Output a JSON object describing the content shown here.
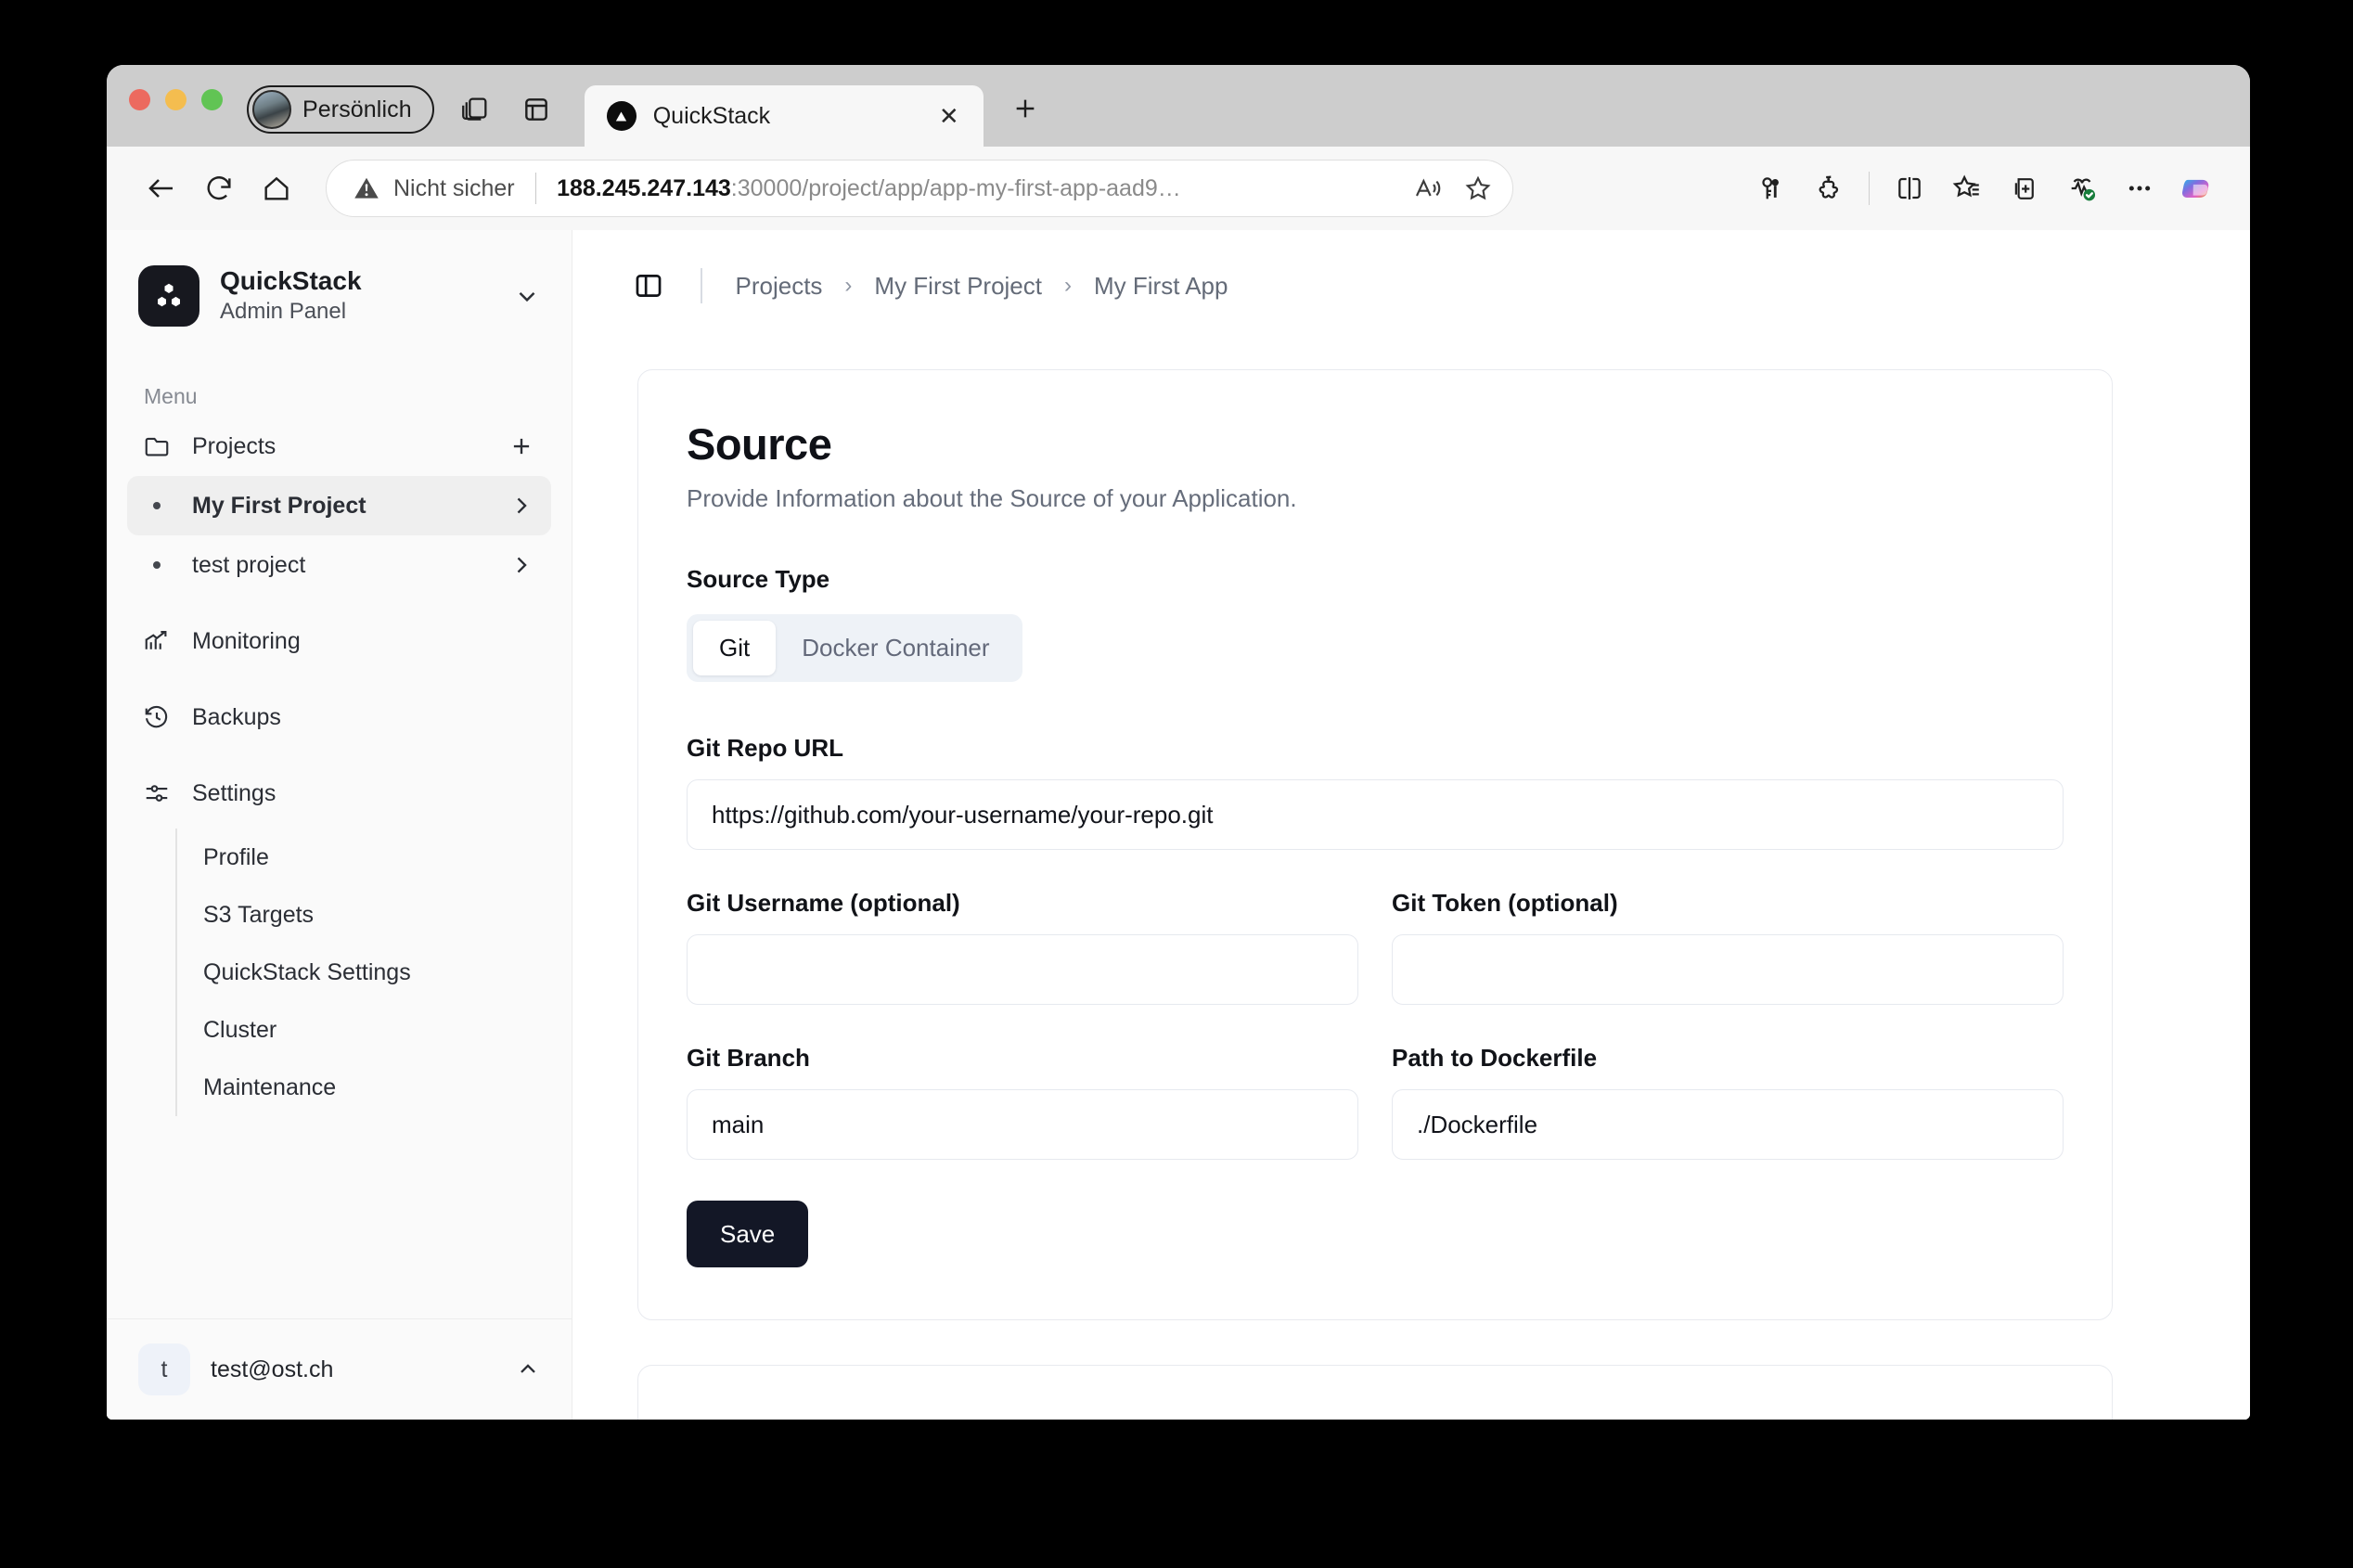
{
  "browser": {
    "profile_label": "Persönlich",
    "tab": {
      "title": "QuickStack",
      "close_label": "✕"
    },
    "new_tab_label": "+",
    "omnibox": {
      "security_text": "Nicht sicher",
      "url_host": "188.245.247.143",
      "url_rest": ":30000/project/app/app-my-first-app-aad9…"
    },
    "toolbar_icons": [
      "back-icon",
      "reload-icon",
      "home-icon",
      "read-aloud-icon",
      "favorite-star-icon",
      "passwords-icon",
      "extensions-icon",
      "split-screen-icon",
      "favorites-icon",
      "collections-icon",
      "browser-essentials-icon",
      "more-options-icon",
      "copilot-icon"
    ]
  },
  "sidebar": {
    "brand": {
      "name": "QuickStack",
      "subtitle": "Admin Panel"
    },
    "menu_label": "Menu",
    "items": [
      {
        "label": "Projects",
        "icon": "folder-icon",
        "action": "add-project-icon"
      },
      {
        "label": "My First Project",
        "icon": "bullet",
        "active": true,
        "tail": "chevron-right-icon"
      },
      {
        "label": "test project",
        "icon": "bullet",
        "active": false,
        "tail": "chevron-right-icon"
      },
      {
        "label": "Monitoring",
        "icon": "chart-trending-up-icon"
      },
      {
        "label": "Backups",
        "icon": "history-clock-icon"
      },
      {
        "label": "Settings",
        "icon": "sliders-icon"
      }
    ],
    "settings_subitems": [
      {
        "label": "Profile"
      },
      {
        "label": "S3 Targets"
      },
      {
        "label": "QuickStack Settings"
      },
      {
        "label": "Cluster"
      },
      {
        "label": "Maintenance"
      }
    ],
    "user": {
      "avatar_initial": "t",
      "email": "test@ost.ch",
      "chevron": "chevron-up-icon"
    }
  },
  "breadcrumb": {
    "items": [
      "Projects",
      "My First Project",
      "My First App"
    ],
    "separator": "›"
  },
  "source_card": {
    "title": "Source",
    "subtitle": "Provide Information about the Source of your Application.",
    "source_type": {
      "label": "Source Type",
      "options": [
        "Git",
        "Docker Container"
      ],
      "selected": "Git"
    },
    "fields": {
      "repo": {
        "label": "Git Repo URL",
        "value": "https://github.com/your-username/your-repo.git"
      },
      "username": {
        "label": "Git Username (optional)",
        "value": ""
      },
      "token": {
        "label": "Git Token (optional)",
        "value": ""
      },
      "branch": {
        "label": "Git Branch",
        "value": "main"
      },
      "dockerfile": {
        "label": "Path to Dockerfile",
        "value": "./Dockerfile"
      }
    },
    "save_label": "Save"
  },
  "colors": {
    "accent_dark": "#131726",
    "segment_bg": "#eef2f7",
    "card_border": "#e8eaef",
    "sidebar_bg": "#fafafa"
  }
}
